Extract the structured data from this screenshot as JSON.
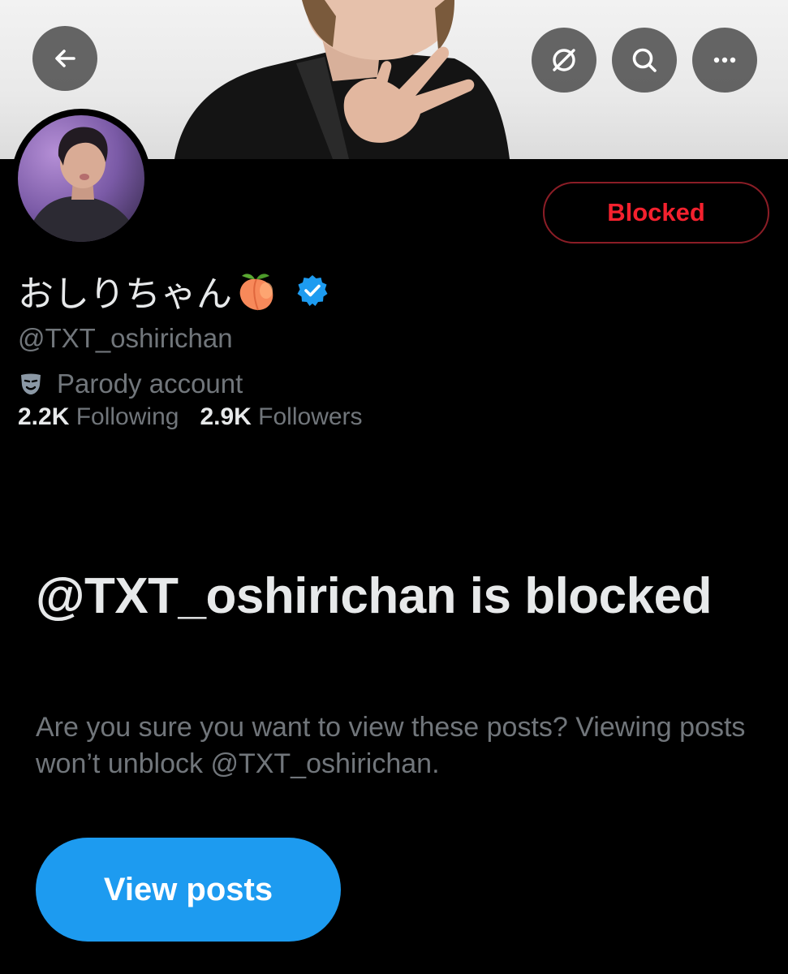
{
  "header": {
    "back_icon": "arrow-left-icon",
    "grok_icon": "grok-icon",
    "search_icon": "search-icon",
    "more_icon": "more-horizontal-icon"
  },
  "profile": {
    "display_name": "おしりちゃん",
    "name_emoji": "peach-icon",
    "verified": true,
    "handle": "@TXT_oshirichan",
    "parody_label": "Parody account",
    "following_count": "2.2K",
    "following_label": "Following",
    "followers_count": "2.9K",
    "followers_label": "Followers",
    "blocked_button_label": "Blocked"
  },
  "blocked_notice": {
    "title": "@TXT_oshirichan is blocked",
    "description": "Are you sure you want to view these posts? Viewing posts won’t unblock @TXT_oshirichan.",
    "view_button_label": "View posts"
  },
  "colors": {
    "background": "#000000",
    "primary_text": "#e7e9ea",
    "secondary_text": "#71767b",
    "accent_blue": "#1d9bf0",
    "blocked_red": "#f4212e"
  }
}
